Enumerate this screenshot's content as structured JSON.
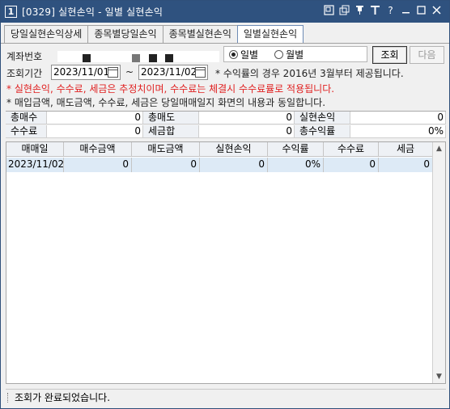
{
  "window": {
    "number": "1",
    "title": "[0329] 실현손익 - 일별 실현손익"
  },
  "title_icons": [
    "restore-icon",
    "copy-icon",
    "pin-icon",
    "text-icon",
    "help-icon",
    "minimize-icon",
    "maximize-icon",
    "close-icon"
  ],
  "tabs": [
    {
      "label": "당일실현손익상세",
      "active": false
    },
    {
      "label": "종목별당일손익",
      "active": false
    },
    {
      "label": "종목별실현손익",
      "active": false
    },
    {
      "label": "일별실현손익",
      "active": true
    }
  ],
  "form": {
    "account_label": "계좌번호",
    "radio_daily": "일별",
    "radio_monthly": "월별",
    "selected": "일별",
    "query_button": "조회",
    "next_button": "다음",
    "period_label": "조회기간",
    "date_from": "2023/11/01",
    "date_sep": "~",
    "date_to": "2023/11/02",
    "period_note": "* 수익률의 경우 2016년 3월부터 제공됩니다."
  },
  "notes": {
    "red": "* 실현손익, 수수료, 세금은 추정치이며, 수수료는 체결시 수수료률로 적용됩니다.",
    "info": "* 매입금액, 매도금액, 수수료, 세금은 당일매매일지 화면의 내용과 동일합니다."
  },
  "summary": {
    "row1": [
      {
        "label": "총매수",
        "value": "0"
      },
      {
        "label": "총매도",
        "value": "0"
      },
      {
        "label": "실현손익",
        "value": "0"
      }
    ],
    "row2": [
      {
        "label": "수수료",
        "value": "0"
      },
      {
        "label": "세금합",
        "value": "0"
      },
      {
        "label": "총수익률",
        "value": "0%"
      }
    ]
  },
  "grid": {
    "columns": [
      "매매일",
      "매수금액",
      "매도금액",
      "실현손익",
      "수익률",
      "수수료",
      "세금"
    ],
    "rows": [
      [
        "2023/11/02",
        "0",
        "0",
        "0",
        "0%",
        "0",
        "0"
      ]
    ]
  },
  "status": {
    "message": "조회가 완료되었습니다."
  },
  "colors": {
    "titlebar": "#2f527f",
    "warning_text": "#e02020",
    "selected_row": "#ddeaf6"
  }
}
